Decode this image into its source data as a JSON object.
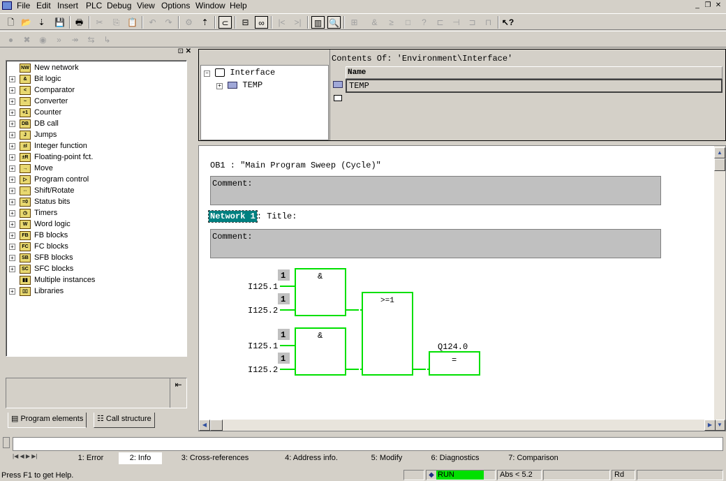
{
  "menu": [
    "File",
    "Edit",
    "Insert",
    "PLC",
    "Debug",
    "View",
    "Options",
    "Window",
    "Help"
  ],
  "left_tree": [
    {
      "label": "New network",
      "expandable": false,
      "icon": "new-network-icon"
    },
    {
      "label": "Bit logic",
      "expandable": true,
      "icon": "bit-logic-icon"
    },
    {
      "label": "Comparator",
      "expandable": true,
      "icon": "comparator-icon"
    },
    {
      "label": "Converter",
      "expandable": true,
      "icon": "converter-icon"
    },
    {
      "label": "Counter",
      "expandable": true,
      "icon": "counter-icon"
    },
    {
      "label": "DB call",
      "expandable": true,
      "icon": "db-call-icon"
    },
    {
      "label": "Jumps",
      "expandable": true,
      "icon": "jumps-icon"
    },
    {
      "label": "Integer function",
      "expandable": true,
      "icon": "integer-function-icon"
    },
    {
      "label": "Floating-point fct.",
      "expandable": true,
      "icon": "floating-point-icon"
    },
    {
      "label": "Move",
      "expandable": true,
      "icon": "move-icon"
    },
    {
      "label": "Program control",
      "expandable": true,
      "icon": "program-control-icon"
    },
    {
      "label": "Shift/Rotate",
      "expandable": true,
      "icon": "shift-rotate-icon"
    },
    {
      "label": "Status bits",
      "expandable": true,
      "icon": "status-bits-icon"
    },
    {
      "label": "Timers",
      "expandable": true,
      "icon": "timers-icon"
    },
    {
      "label": "Word logic",
      "expandable": true,
      "icon": "word-logic-icon"
    },
    {
      "label": "FB blocks",
      "expandable": true,
      "icon": "fb-blocks-icon"
    },
    {
      "label": "FC blocks",
      "expandable": true,
      "icon": "fc-blocks-icon"
    },
    {
      "label": "SFB blocks",
      "expandable": true,
      "icon": "sfb-blocks-icon"
    },
    {
      "label": "SFC blocks",
      "expandable": true,
      "icon": "sfc-blocks-icon"
    },
    {
      "label": "Multiple instances",
      "expandable": false,
      "icon": "multiple-instances-icon"
    },
    {
      "label": "Libraries",
      "expandable": true,
      "icon": "libraries-icon"
    }
  ],
  "left_tabs": {
    "program_elements": "Program elements",
    "call_structure": "Call structure"
  },
  "interface": {
    "root": "Interface",
    "child": "TEMP",
    "contents_title": "Contents Of: 'Environment\\Interface'",
    "column_name": "Name",
    "row_value": "TEMP"
  },
  "code": {
    "block_title": "OB1 :  \"Main Program Sweep (Cycle)\"",
    "comment_label": "Comment:",
    "network_label": "Network 1",
    "network_title": ": Title:",
    "network_comment": "Comment:",
    "fbd": {
      "and1": {
        "op": "&",
        "in1": "I125.1",
        "in2": "I125.2",
        "pin1": "1",
        "pin2": "1"
      },
      "and2": {
        "op": "&",
        "in1": "I125.1",
        "in2": "I125.2",
        "pin1": "1",
        "pin2": "1"
      },
      "or": {
        "op": ">=1"
      },
      "assign": {
        "op": "=",
        "operand": "Q124.0"
      }
    }
  },
  "bottom_tabs": [
    "1: Error",
    "2: Info",
    "3: Cross-references",
    "4: Address info.",
    "5: Modify",
    "6: Diagnostics",
    "7: Comparison"
  ],
  "status": {
    "help": "Press F1 to get Help.",
    "mode": "RUN",
    "abs": "Abs < 5.2",
    "rd": "Rd"
  },
  "colors": {
    "fbd_green": "#00e000",
    "run_green": "#00e000",
    "network_teal": "#008080"
  }
}
